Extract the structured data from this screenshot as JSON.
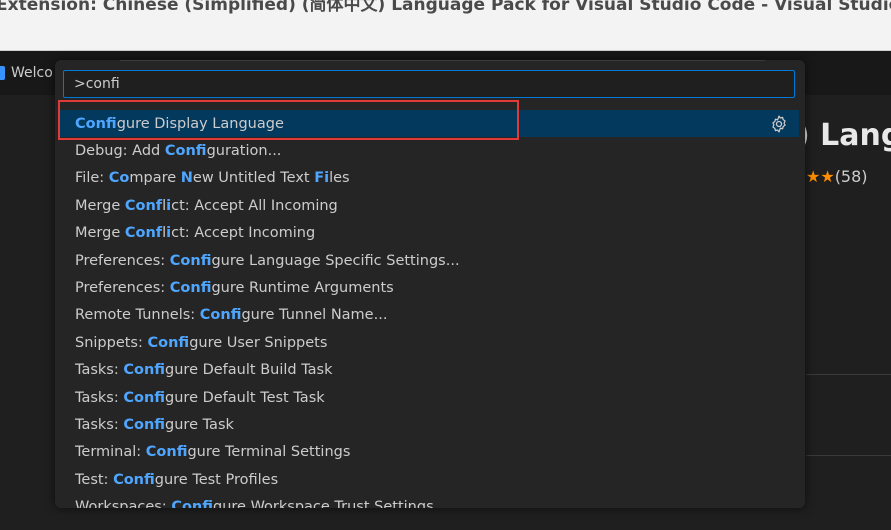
{
  "window": {
    "title": "Extension: Chinese (Simplified) (简体中文) Language Pack for Visual Studio Code - Visual Studio Code"
  },
  "tab": {
    "label": "Welco"
  },
  "background": {
    "heading": ") Lang",
    "stars": "★★",
    "rating_count": "(58)"
  },
  "palette": {
    "query": ">confi",
    "items": [
      {
        "label": "Configure Display Language",
        "selected": true
      },
      {
        "label": "Debug: Add Configuration..."
      },
      {
        "label": "File: Compare New Untitled Text Files"
      },
      {
        "label": "Merge Conflict: Accept All Incoming"
      },
      {
        "label": "Merge Conflict: Accept Incoming"
      },
      {
        "label": "Preferences: Configure Language Specific Settings..."
      },
      {
        "label": "Preferences: Configure Runtime Arguments"
      },
      {
        "label": "Remote Tunnels: Configure Tunnel Name..."
      },
      {
        "label": "Snippets: Configure User Snippets"
      },
      {
        "label": "Tasks: Configure Default Build Task"
      },
      {
        "label": "Tasks: Configure Default Test Task"
      },
      {
        "label": "Tasks: Configure Task"
      },
      {
        "label": "Terminal: Configure Terminal Settings"
      },
      {
        "label": "Test: Configure Test Profiles"
      },
      {
        "label": "Workspaces: Configure Workspace Trust Settings"
      }
    ]
  },
  "colors": {
    "highlight": "#4fa6ff",
    "selection": "#04395e",
    "annotation_box": "#e03a3a",
    "accent": "#0078d4"
  },
  "icons": {
    "gear": "gear-icon"
  }
}
